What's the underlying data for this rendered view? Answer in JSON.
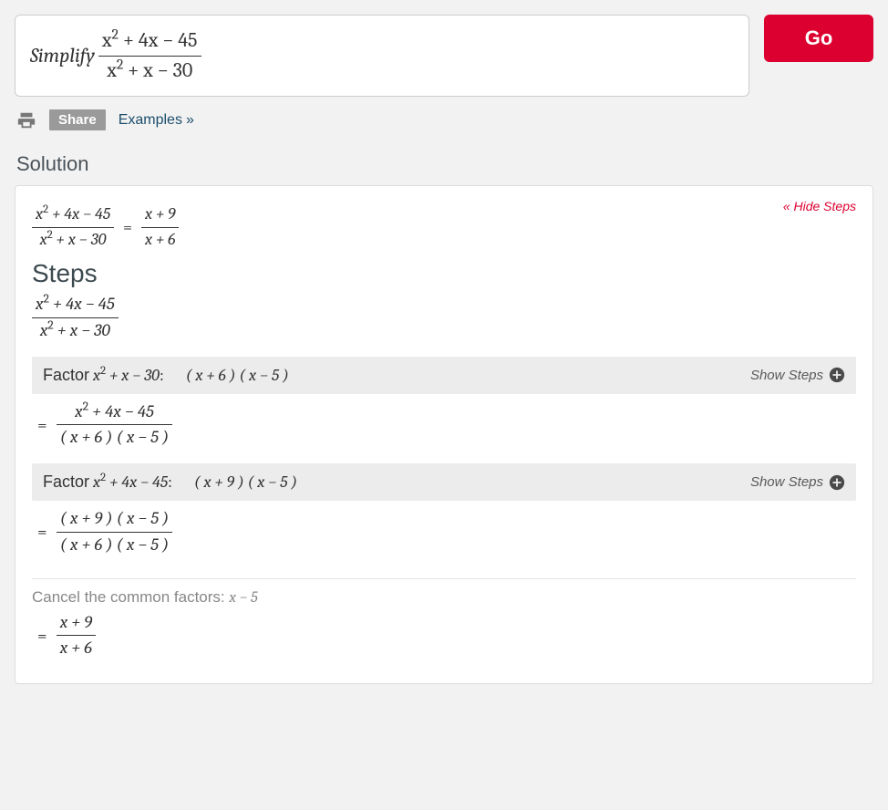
{
  "input": {
    "prefix_label": "Simplify",
    "numer_html": "x<sup>2</sup> + 4x − 45",
    "denom_html": "x<sup>2</sup> + x − 30"
  },
  "go_label": "Go",
  "toolbar": {
    "share_label": "Share",
    "examples_label": "Examples"
  },
  "solution_heading": "Solution",
  "hide_steps_label": "« Hide Steps",
  "steps_heading": "Steps",
  "result": {
    "lhs_numer": "x<sup>2</sup> + 4x − 45",
    "lhs_denom": "x<sup>2</sup> + x − 30",
    "rhs_numer": "x + 9",
    "rhs_denom": "x + 6"
  },
  "initial_frac": {
    "numer": "x<sup>2</sup> + 4x − 45",
    "denom": "x<sup>2</sup> + x − 30"
  },
  "factor1": {
    "label": "Factor",
    "expr": "x<sup>2</sup> + x − 30",
    "result": "( x + 6 ) ( x − 5 )",
    "show_label": "Show Steps",
    "after_numer": "x<sup>2</sup> + 4x − 45",
    "after_denom": "( x + 6 ) ( x − 5 )"
  },
  "factor2": {
    "label": "Factor",
    "expr": "x<sup>2</sup> + 4x − 45",
    "result": "( x + 9 ) ( x − 5 )",
    "show_label": "Show Steps",
    "after_numer": "( x + 9 ) ( x − 5 )",
    "after_denom": "( x + 6 ) ( x − 5 )"
  },
  "cancel": {
    "text": "Cancel the common factors:",
    "factor": "x − 5",
    "final_numer": "x + 9",
    "final_denom": "x + 6"
  }
}
